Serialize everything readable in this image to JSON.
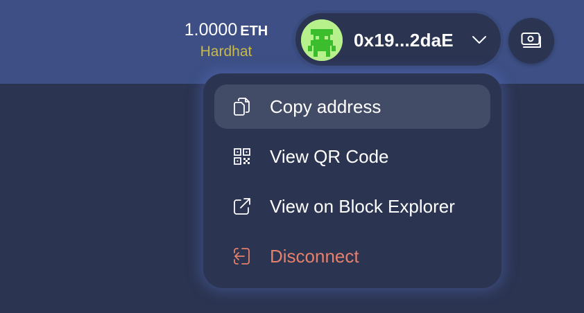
{
  "header": {
    "balance": {
      "amount": "1.0000",
      "unit": "ETH"
    },
    "network": "Hardhat",
    "account": {
      "address": "0x19...2daE",
      "avatar_icon": "pixel-avatar-icon",
      "avatar_color": "#b7f18b",
      "chevron_icon": "chevron-down-icon"
    },
    "wallet_button": {
      "icon": "wallet-cash-icon"
    }
  },
  "dropdown": {
    "items": [
      {
        "label": "Copy address",
        "icon": "copy-icon",
        "active": true
      },
      {
        "label": "View QR Code",
        "icon": "qr-code-icon"
      },
      {
        "label": "View on Block Explorer",
        "icon": "external-link-icon"
      },
      {
        "label": "Disconnect",
        "icon": "logout-icon",
        "danger": true
      }
    ]
  },
  "colors": {
    "header_bg": "#3d4f84",
    "page_bg": "#2b3451",
    "network": "#c9ba48",
    "danger": "#e5806b",
    "active_item_bg": "#434c66"
  }
}
